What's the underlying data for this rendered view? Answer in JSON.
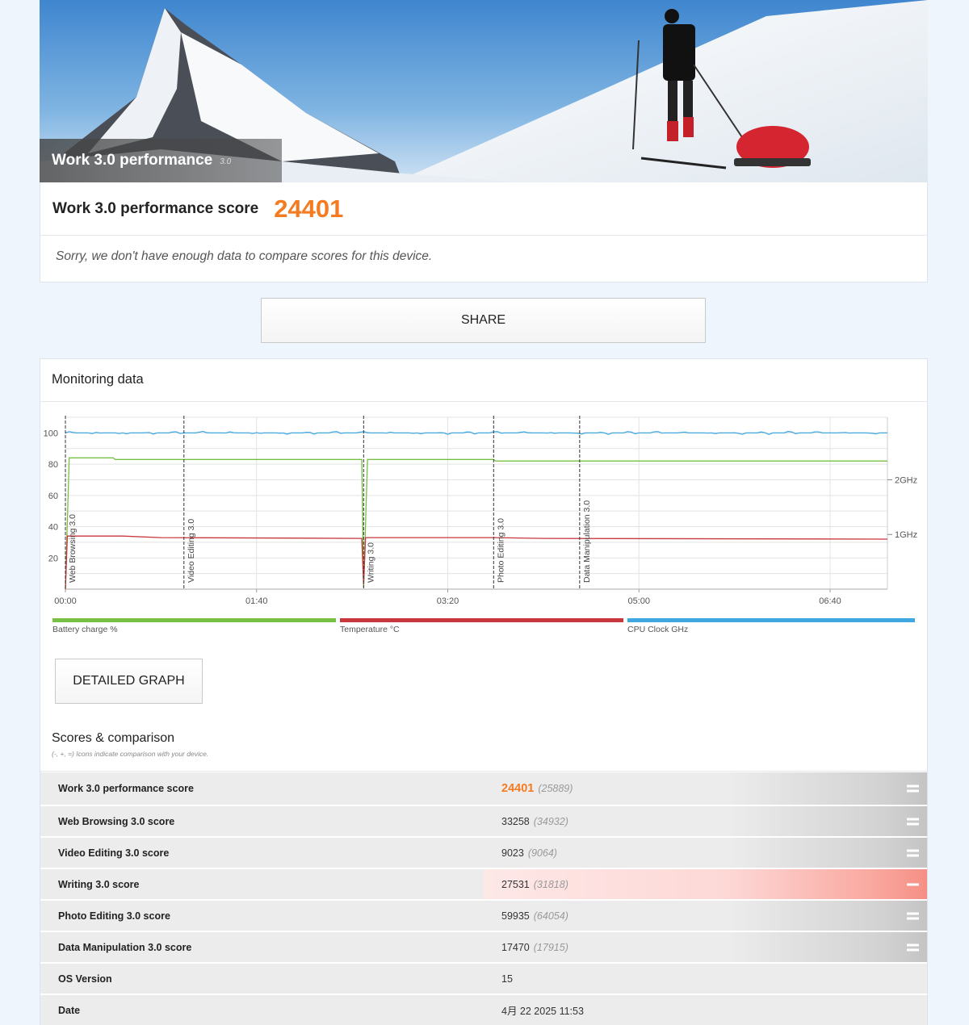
{
  "hero": {
    "title": "Work 3.0 performance",
    "version": "3.0"
  },
  "score": {
    "label": "Work 3.0 performance score",
    "value": "24401",
    "note": "Sorry, we don't have enough data to compare scores for this device."
  },
  "share_label": "SHARE",
  "monitoring": {
    "title": "Monitoring data",
    "detail_button": "DETAILED GRAPH",
    "legend": [
      {
        "label": "Battery charge %",
        "color": "#77c043"
      },
      {
        "label": "Temperature °C",
        "color": "#c8373c"
      },
      {
        "label": "CPU Clock GHz",
        "color": "#40a8e0"
      }
    ]
  },
  "chart_data": {
    "type": "line",
    "x_ticks": [
      "00:00",
      "01:40",
      "03:20",
      "05:00",
      "06:40"
    ],
    "y_left_ticks": [
      "100",
      "80",
      "60",
      "40",
      "20"
    ],
    "y_right_ticks": [
      "2GHz",
      "1GHz"
    ],
    "ylim": [
      0,
      110
    ],
    "xlim_seconds": [
      0,
      430
    ],
    "markers": [
      {
        "label": "Web Browsing 3.0",
        "t": 0
      },
      {
        "label": "Video Editing 3.0",
        "t": 62
      },
      {
        "label": "Writing 3.0",
        "t": 156
      },
      {
        "label": "Photo Editing 3.0",
        "t": 224
      },
      {
        "label": "Data Manipulation 3.0",
        "t": 269
      }
    ],
    "series": [
      {
        "name": "Battery charge %",
        "color": "#77c043",
        "points": [
          [
            0,
            0
          ],
          [
            2,
            84
          ],
          [
            25,
            84
          ],
          [
            26,
            83
          ],
          [
            155,
            83
          ],
          [
            156,
            1
          ],
          [
            158,
            83
          ],
          [
            224,
            83
          ],
          [
            225,
            82
          ],
          [
            430,
            82
          ]
        ]
      },
      {
        "name": "Temperature °C",
        "color": "#c8373c",
        "points": [
          [
            0,
            0
          ],
          [
            1,
            34
          ],
          [
            30,
            34
          ],
          [
            50,
            33
          ],
          [
            155,
            32.5
          ],
          [
            156,
            3
          ],
          [
            157,
            33
          ],
          [
            224,
            33
          ],
          [
            250,
            32.5
          ],
          [
            430,
            32
          ]
        ]
      },
      {
        "name": "CPU Clock GHz",
        "color": "#40a8e0",
        "points": [
          [
            0,
            100
          ],
          [
            430,
            100
          ]
        ]
      }
    ],
    "grid": true
  },
  "scores": {
    "title": "Scores & comparison",
    "subtitle": "(-, +, =) Icons indicate comparison with your device.",
    "rows": [
      {
        "label": "Work 3.0 performance score",
        "value": "24401",
        "compare": "(25889)",
        "icon": "equal"
      },
      {
        "label": "Web Browsing 3.0 score",
        "value": "33258",
        "compare": "(34932)",
        "icon": "equal"
      },
      {
        "label": "Video Editing 3.0 score",
        "value": "9023",
        "compare": "(9064)",
        "icon": "equal"
      },
      {
        "label": "Writing 3.0 score",
        "value": "27531",
        "compare": "(31818)",
        "icon": "minus"
      },
      {
        "label": "Photo Editing 3.0 score",
        "value": "59935",
        "compare": "(64054)",
        "icon": "equal"
      },
      {
        "label": "Data Manipulation 3.0 score",
        "value": "17470",
        "compare": "(17915)",
        "icon": "equal"
      },
      {
        "label": "OS Version",
        "value": "15",
        "compare": "",
        "icon": ""
      },
      {
        "label": "Date",
        "value": "4月 22 2025 11:53",
        "compare": "",
        "icon": ""
      }
    ]
  }
}
